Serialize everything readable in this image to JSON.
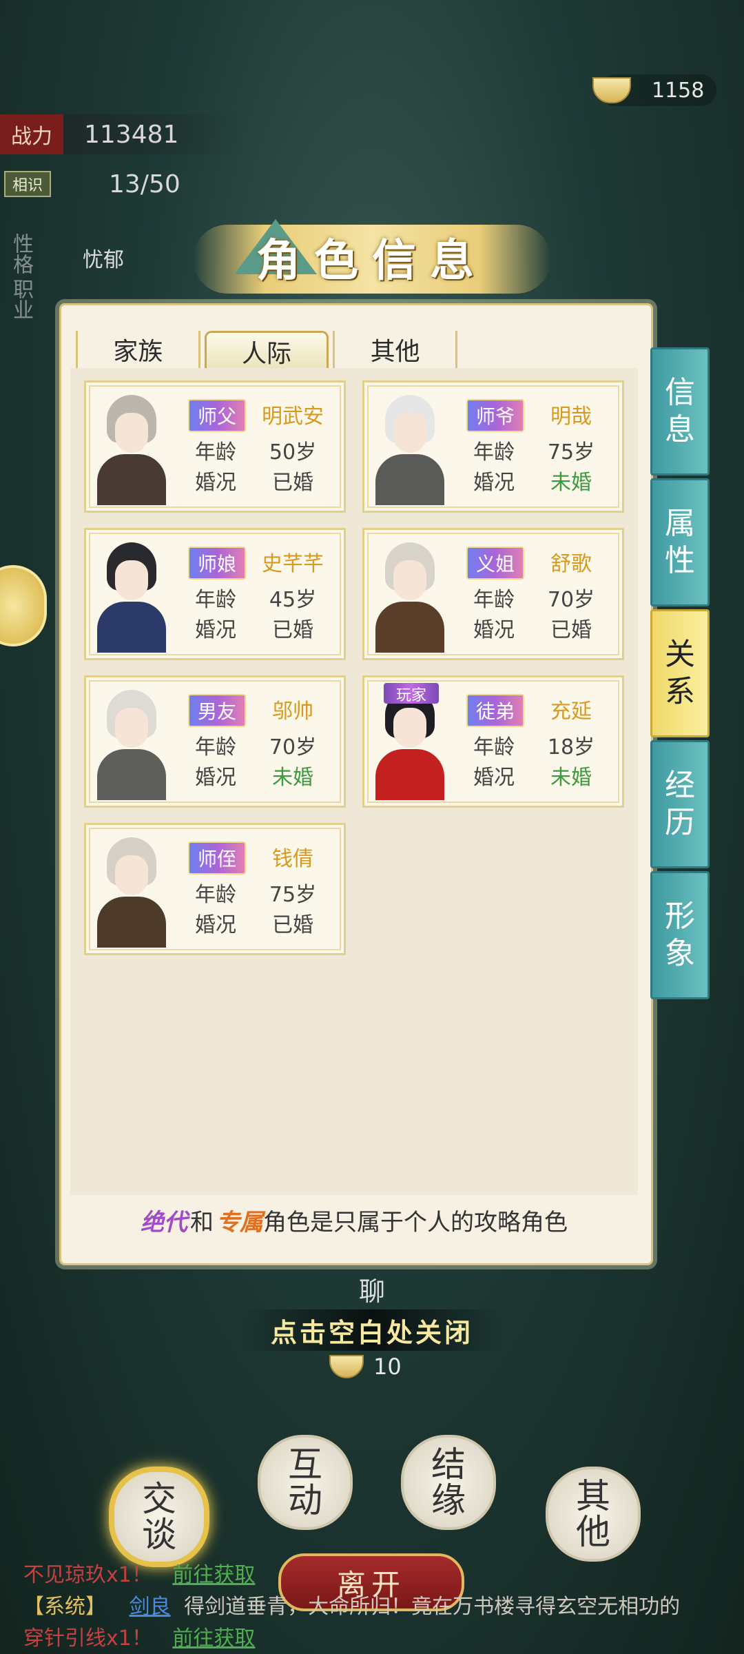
{
  "currency": {
    "amount": "1158"
  },
  "stats": {
    "power_label": "战力",
    "power_value": "113481",
    "acquaint_label": "相识",
    "acquaint_value": "13/50",
    "personality_label": "性格",
    "personality_value": "忧郁",
    "job_label": "职业"
  },
  "title": "角色信息",
  "tabs": [
    {
      "label": "家族"
    },
    {
      "label": "人际"
    },
    {
      "label": "其他"
    }
  ],
  "side_tabs": [
    "信息",
    "属性",
    "关系",
    "经历",
    "形象"
  ],
  "field_labels": {
    "age": "年龄",
    "marital": "婚况"
  },
  "cards": [
    {
      "role": "师父",
      "name": "明武安",
      "age": "50岁",
      "marital": "已婚"
    },
    {
      "role": "师爷",
      "name": "明哉",
      "age": "75岁",
      "marital": "未婚"
    },
    {
      "role": "师娘",
      "name": "史芊芊",
      "age": "45岁",
      "marital": "已婚"
    },
    {
      "role": "义姐",
      "name": "舒歌",
      "age": "70岁",
      "marital": "已婚"
    },
    {
      "role": "男友",
      "name": "邬帅",
      "age": "70岁",
      "marital": "未婚"
    },
    {
      "role": "徒弟",
      "name": "充延",
      "age": "18岁",
      "marital": "未婚",
      "tag": "玩家"
    },
    {
      "role": "师侄",
      "name": "钱倩",
      "age": "75岁",
      "marital": "已婚"
    }
  ],
  "footer": {
    "part1": "绝代",
    "part2": "和",
    "part3": "专属",
    "part4": "角色是只属于个人的攻略角色"
  },
  "close_hint": "点击空白处关闭",
  "chat_label": "聊",
  "cost": "10",
  "actions": [
    "交谈",
    "互动",
    "结缘",
    "其他"
  ],
  "leave": "离开",
  "log": {
    "line1_a": "不见琼玖x1！",
    "line1_b": "前往获取",
    "line2_tag": "【系统】",
    "line2_name": "剑良",
    "line2_text": "得剑道垂青，大命所归！竟在万书楼寻得玄空无相功的",
    "line3_a": "穿针引线x1！",
    "line3_b": "前往获取"
  }
}
